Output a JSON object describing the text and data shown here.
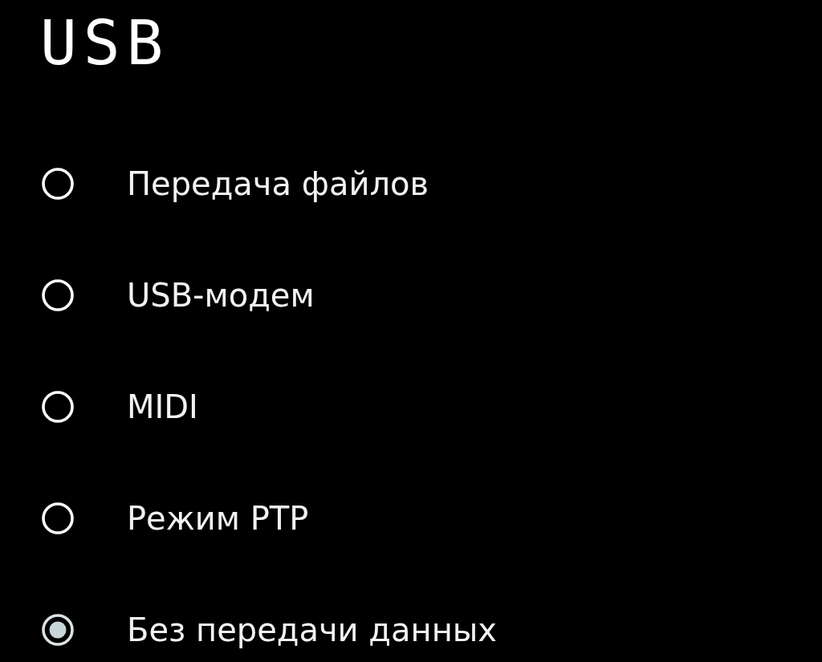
{
  "title": "USB",
  "options": [
    {
      "label": "Передача файлов",
      "selected": false
    },
    {
      "label": "USB-модем",
      "selected": false
    },
    {
      "label": "MIDI",
      "selected": false
    },
    {
      "label": "Режим PTP",
      "selected": false
    },
    {
      "label": "Без передачи данных",
      "selected": true
    }
  ]
}
